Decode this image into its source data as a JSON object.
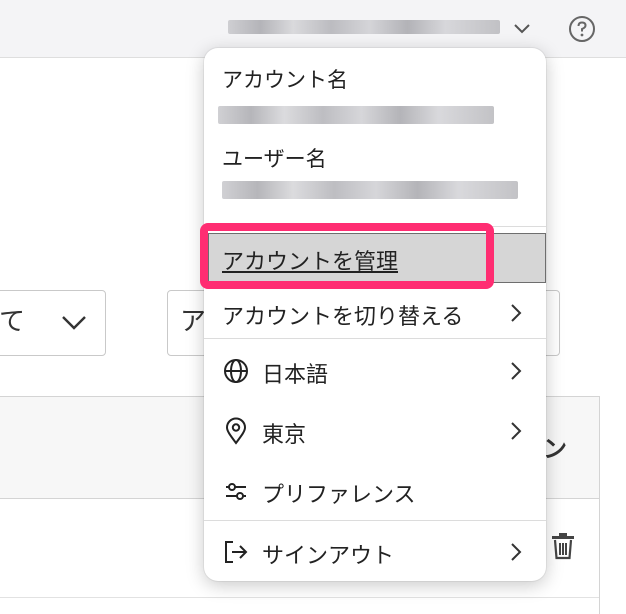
{
  "header": {
    "account_trigger_label": "",
    "help_icon": "question-circle-icon"
  },
  "background": {
    "select_left_text": "て",
    "select_right_text": "ア",
    "table_header_partial": "ン"
  },
  "menu": {
    "account_name_label": "アカウント名",
    "user_name_label": "ユーザー名",
    "items": [
      {
        "label": "アカウントを管理",
        "icon": null,
        "chevron": false
      },
      {
        "label": "アカウントを切り替える",
        "icon": null,
        "chevron": true
      },
      {
        "label": "日本語",
        "icon": "globe-icon",
        "chevron": true
      },
      {
        "label": "東京",
        "icon": "location-pin-icon",
        "chevron": true
      },
      {
        "label": "プリファレンス",
        "icon": "sliders-icon",
        "chevron": false
      },
      {
        "label": "サインアウト",
        "icon": "sign-out-icon",
        "chevron": true
      }
    ]
  },
  "colors": {
    "callout": "#ff2d72",
    "highlight_bg": "#d6d6d6",
    "topbar_bg": "#f4f4f6"
  }
}
